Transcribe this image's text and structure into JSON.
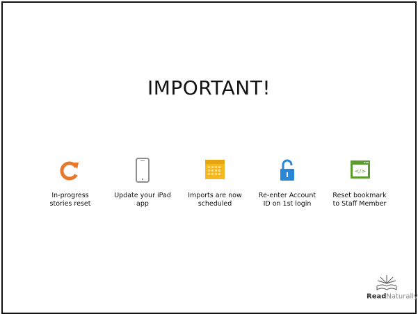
{
  "slide": {
    "title": "IMPORTANT!",
    "items": [
      {
        "line1": "In-progress",
        "line2": "stories reset",
        "icon": "refresh-icon",
        "color": "#E8782A"
      },
      {
        "line1": "Update your iPad",
        "line2": "app",
        "icon": "tablet-icon",
        "color": "#8E8E8E"
      },
      {
        "line1": "Imports are now",
        "line2": "scheduled",
        "icon": "calendar-icon",
        "color": "#F5B820"
      },
      {
        "line1": "Re-enter Account",
        "line2": "ID on 1st login",
        "icon": "unlocked-padlock-icon",
        "color": "#2A86D6"
      },
      {
        "line1": "Reset bookmark",
        "line2": "to Staff Member",
        "icon": "browser-code-icon",
        "color": "#5C9C2E"
      }
    ]
  },
  "logo": {
    "bold": "Read",
    "light": "Naturally",
    "mark": "®"
  }
}
